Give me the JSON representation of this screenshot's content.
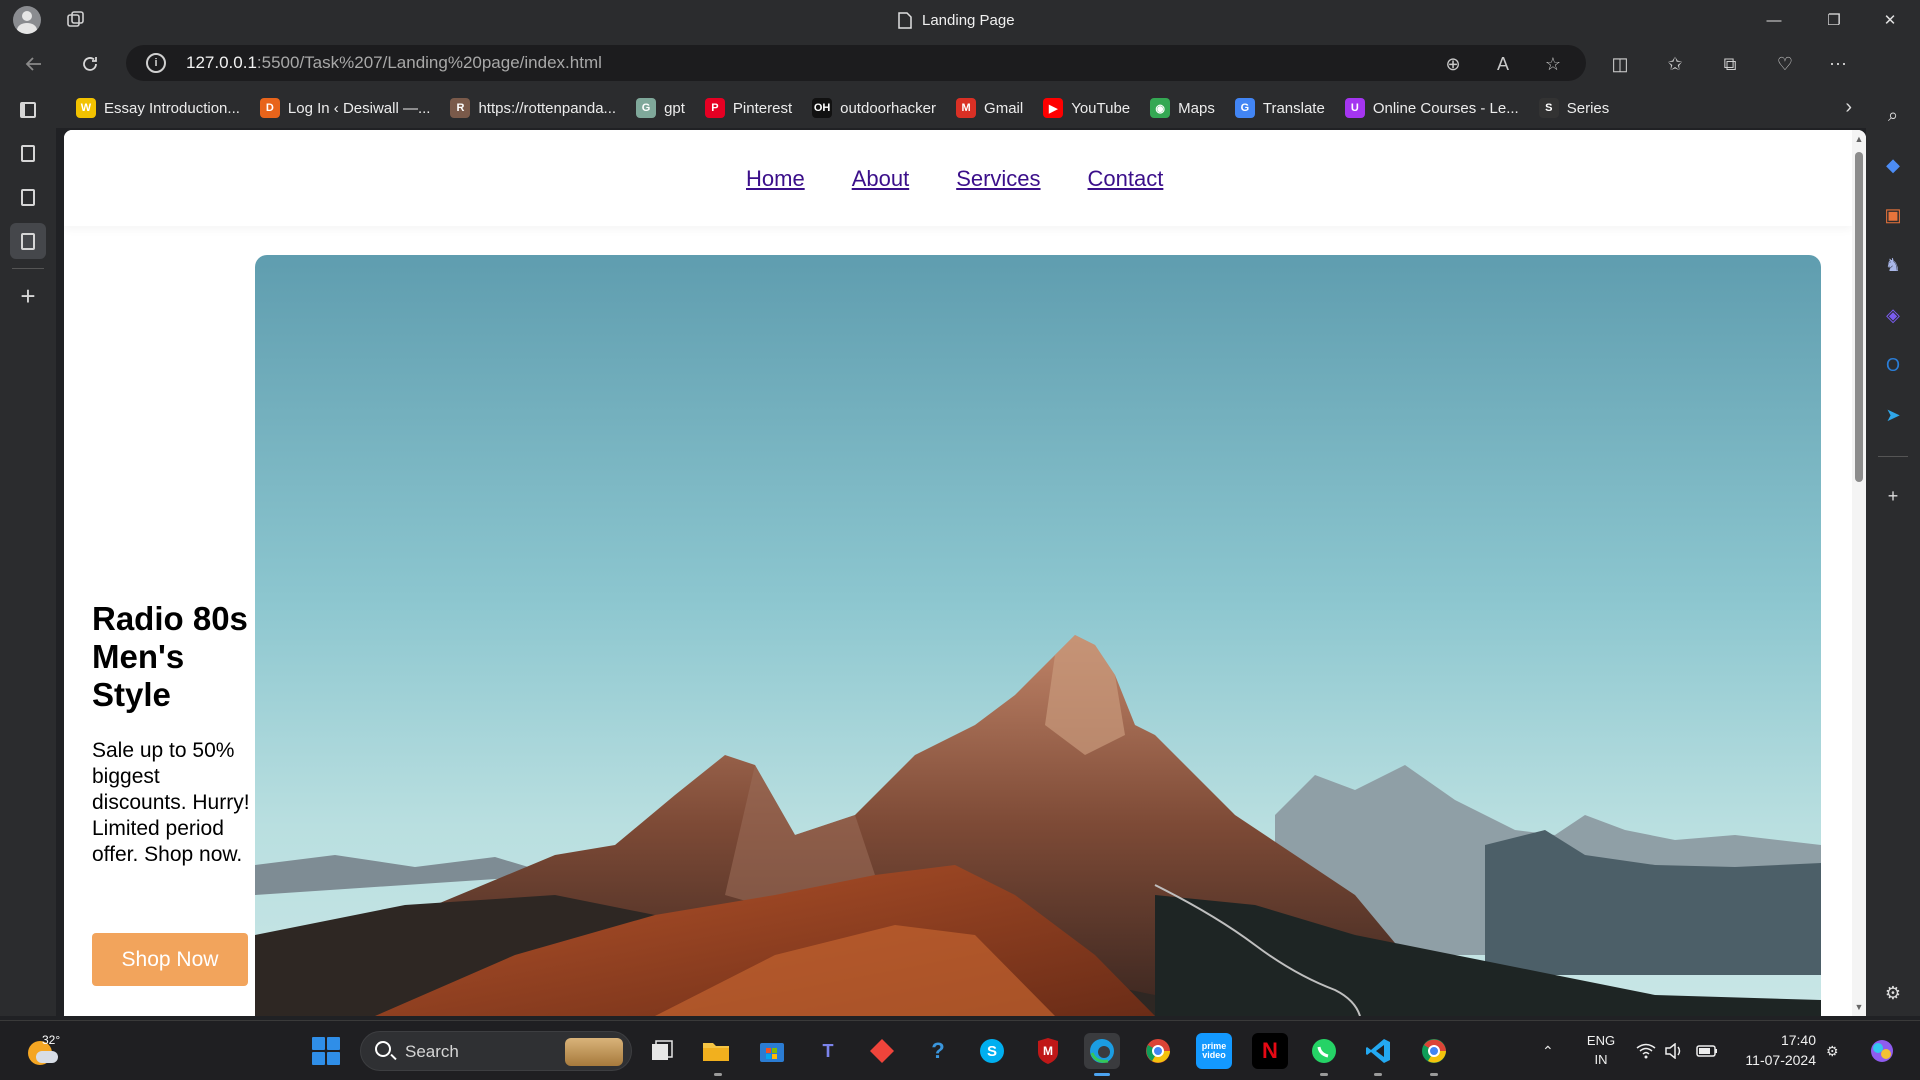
{
  "window": {
    "title": "Landing Page",
    "minimize_glyph": "—",
    "maximize_glyph": "❐",
    "close_glyph": "✕"
  },
  "address_bar": {
    "url_host": "127.0.0.1",
    "url_path": ":5500/Task%207/Landing%20page/index.html"
  },
  "bookmarks": [
    {
      "label": "Essay Introduction...",
      "icon": "W",
      "color": "#f2c200"
    },
    {
      "label": "Log In ‹ Desiwall —...",
      "icon": "D",
      "color": "#e8641b"
    },
    {
      "label": "https://rottenpanda...",
      "icon": "R",
      "color": "#7a5a4a"
    },
    {
      "label": "gpt",
      "icon": "G",
      "color": "#7fa89a"
    },
    {
      "label": "Pinterest",
      "icon": "P",
      "color": "#e60023"
    },
    {
      "label": "outdoorhacker",
      "icon": "OH",
      "color": "#111111"
    },
    {
      "label": "Gmail",
      "icon": "M",
      "color": "#d93025"
    },
    {
      "label": "YouTube",
      "icon": "▶",
      "color": "#ff0000"
    },
    {
      "label": "Maps",
      "icon": "◉",
      "color": "#34a853"
    },
    {
      "label": "Translate",
      "icon": "G",
      "color": "#4285f4"
    },
    {
      "label": "Online Courses - Le...",
      "icon": "U",
      "color": "#a435f0"
    },
    {
      "label": "Series",
      "icon": "S",
      "color": "#333333"
    }
  ],
  "site": {
    "nav": [
      "Home",
      "About",
      "Services",
      "Contact"
    ],
    "hero_title": "Radio 80s Men's Style",
    "hero_text": "Sale up to 50% biggest discounts. Hurry! Limited period offer. Shop now.",
    "cta": "Shop Now"
  },
  "taskbar": {
    "weather_temp": "32°",
    "search_placeholder": "Search",
    "lang_line1": "ENG",
    "lang_line2": "IN",
    "time": "17:40",
    "date": "11-07-2024"
  },
  "colors": {
    "cta": "#f2a45c",
    "link": "#3b0f8a",
    "chrome": "#2b2c2e"
  }
}
